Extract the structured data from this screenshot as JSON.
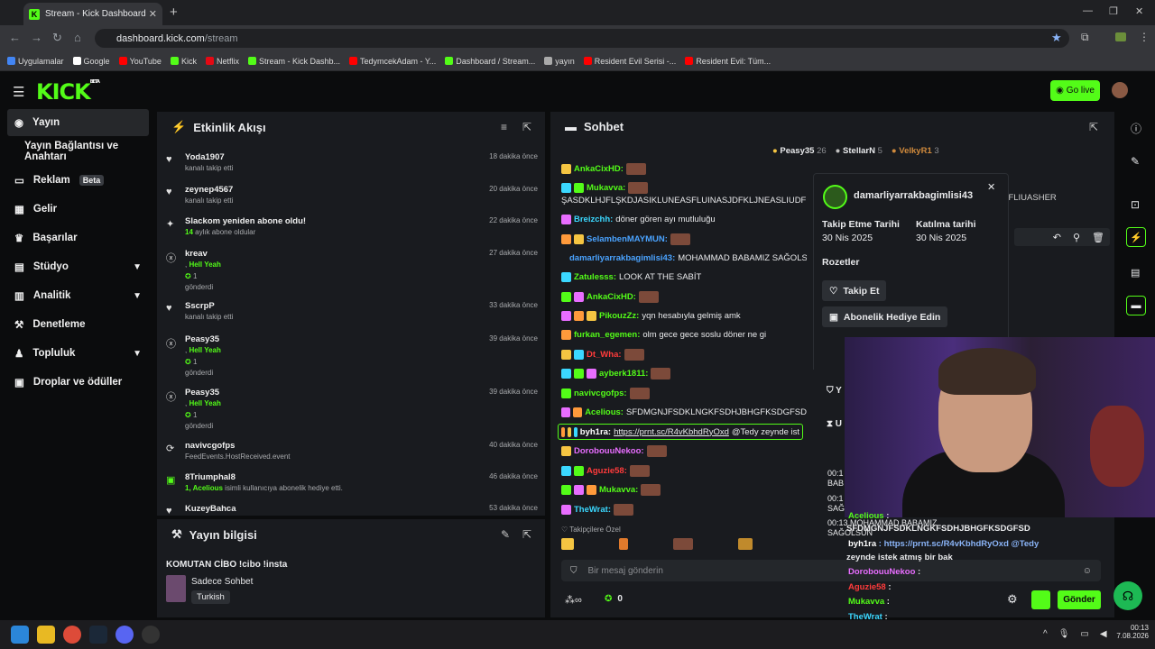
{
  "browser": {
    "tab_title": "Stream - Kick Dashboard",
    "url_host": "dashboard.kick.com",
    "url_path": "/stream",
    "bookmarks": [
      "Uygulamalar",
      "Google",
      "YouTube",
      "Kick",
      "Netflix",
      "Stream - Kick Dashb...",
      "TedymcekAdam - Y...",
      "Dashboard / Stream...",
      "yayın",
      "Resident Evil Serisi -...",
      "Resident Evil: Tüm..."
    ]
  },
  "header": {
    "logo": "KICK",
    "logo_sup": "BETA",
    "go_live": "Go live"
  },
  "sidebar": {
    "items": [
      {
        "label": "Yayın",
        "icon": "broadcast-icon"
      },
      {
        "label": "Yayın Bağlantısı ve Anahtarı"
      },
      {
        "label": "Reklam",
        "badge": "Beta"
      },
      {
        "label": "Gelir"
      },
      {
        "label": "Başarılar"
      },
      {
        "label": "Stüdyo"
      },
      {
        "label": "Analitik"
      },
      {
        "label": "Denetleme"
      },
      {
        "label": "Topluluk"
      },
      {
        "label": "Droplar ve ödüller"
      }
    ]
  },
  "activity": {
    "title": "Etkinlik Akışı",
    "events": [
      {
        "user": "Yoda1907",
        "line2": "kanalı takip etti",
        "time": "18 dakika önce"
      },
      {
        "user": "zeynep4567",
        "line2": "kanalı takip etti",
        "time": "20 dakika önce"
      },
      {
        "user": "Slackom yeniden abone oldu!",
        "line2_a": "14",
        "line2_b": " aylık abone oldular",
        "time": "22 dakika önce"
      },
      {
        "user": "kreav",
        "line2": "Hell Yeah",
        "line3": "1",
        "line4": "gönderdi",
        "time": "27 dakika önce"
      },
      {
        "user": "SscrpP",
        "line2": "kanalı takip etti",
        "time": "33 dakika önce"
      },
      {
        "user": "Peasy35",
        "line2": "Hell Yeah",
        "line3": "1",
        "line4": "gönderdi",
        "time": "39 dakika önce"
      },
      {
        "user": "Peasy35",
        "line2": "Hell Yeah",
        "line3": "1",
        "line4": "gönderdi",
        "time": "39 dakika önce"
      },
      {
        "user": "navivcgofps",
        "line2": "FeedEvents.HostReceived.event",
        "time": "40 dakika önce"
      },
      {
        "user": "8Triumphal8",
        "line2_a": "1, Acelious",
        "line2_b": " isimli kullanıcıya abonelik hediye etti.",
        "time": "46 dakika önce"
      },
      {
        "user": "KuzeyBahca",
        "line2": "",
        "time": "53 dakika önce"
      }
    ]
  },
  "stream_info": {
    "title": "Yayın bilgisi",
    "stream_title": "KOMUTAN CİBO !cibo !insta",
    "category": "Sadece Sohbet",
    "tag": "Turkish"
  },
  "chat": {
    "title": "Sohbet",
    "leaders": [
      {
        "name": "Peasy35",
        "count": "26"
      },
      {
        "name": "StellarN",
        "count": "5"
      },
      {
        "name": "VelkyR1",
        "count": "3"
      }
    ],
    "messages": [
      {
        "user": "AnkaCixHD:",
        "color": "#53fc18",
        "text": ""
      },
      {
        "user": "Mukavva:",
        "color": "#53fc18",
        "text": ""
      },
      {
        "user": "",
        "color": "#fff",
        "text": "ŞASDKLHJFLŞKDJASIKLUNEASFLUINASJDFKLJNEASLIUDF"
      },
      {
        "user": "Breizchh:",
        "color": "#3bd8ff",
        "text": "döner gören ayı mutluluğu"
      },
      {
        "user": "SelambenMAYMUN:",
        "color": "#4aa3ff",
        "text": ""
      },
      {
        "user": "damarliyarrakbagimlisi43:",
        "color": "#4aa3ff",
        "text": "MOHAMMAD BABAMIZ SAĞOLSUN"
      },
      {
        "user": "Zatulesss:",
        "color": "#53fc18",
        "text": "LOOK AT THE SABİT"
      },
      {
        "user": "AnkaCixHD:",
        "color": "#53fc18",
        "text": ""
      },
      {
        "user": "PikouzZz:",
        "color": "#53fc18",
        "text": "yqn hesabıyla gelmiş amk"
      },
      {
        "user": "furkan_egemen:",
        "color": "#53fc18",
        "text": "olm gece gece soslu döner ne gi"
      },
      {
        "user": "Dt_Wha:",
        "color": "#ff3b3b",
        "text": ""
      },
      {
        "user": "ayberk1811:",
        "color": "#53fc18",
        "text": ""
      },
      {
        "user": "navivcgofps:",
        "color": "#53fc18",
        "text": ""
      },
      {
        "user": "Acelious:",
        "color": "#53fc18",
        "text": "SFDMGNJFSDKLNGKFSDHJBHGFKSDGFSD"
      },
      {
        "user": "byh1ra:",
        "color": "#ffffff",
        "text": "https://prnt.sc/R4vKbhdRyOxd",
        "text2": " @Tedy zeynde ist"
      },
      {
        "user": "DorobouuNekoo:",
        "color": "#e86dff",
        "text": ""
      },
      {
        "user": "Aguzie58:",
        "color": "#ff3b3b",
        "text": ""
      },
      {
        "user": "Mukavva:",
        "color": "#53fc18",
        "text": ""
      },
      {
        "user": "TheWrat:",
        "color": "#3bd8ff",
        "text": ""
      }
    ],
    "pinned_label": "Takipçilere Özel",
    "input_placeholder": "Bir mesaj gönderin",
    "points": "0",
    "send": "Gönder"
  },
  "user_card": {
    "username": "damarliyarrakbagimlisi43",
    "follow_label": "Takip Etme Tarihi",
    "follow_date": "30 Nis 2025",
    "join_label": "Katılma tarihi",
    "join_date": "30 Nis 2025",
    "badges": "Rozetler",
    "follow_btn": "Takip Et",
    "gift_btn": "Abonelik Hediye Edin",
    "behind_text": "NEROFLIUASHER"
  },
  "overlay": {
    "lines": [
      {
        "user": "Acelious",
        "text": " :"
      },
      {
        "user": "",
        "text": "SFDMGNJFSDKLNGKFSDHJBHGFKSDGFSD"
      },
      {
        "user": "byh1ra",
        "text": " : https://prnt.sc/R4vKbhdRyOxd @Tedy"
      },
      {
        "user": "",
        "text": "zeynde istek atmış bir bak"
      },
      {
        "user": "DorobouuNekoo",
        "text": " :"
      },
      {
        "user": "Aguzie58",
        "text": " :"
      },
      {
        "user": "Mukavva",
        "text": " :"
      },
      {
        "user": "TheWrat",
        "text": " :"
      }
    ],
    "times": [
      "00:1",
      "BAB",
      "00:1",
      "SAĞ",
      "00:13 MOHAMMAD BABAMIZ",
      "SAĞOLSUN"
    ]
  },
  "taskbar": {
    "time": "00:13",
    "date": "7.08.2026"
  },
  "colors": {
    "brand": "#53fc18",
    "panel": "#191b1f",
    "bg": "#0b0c0d"
  }
}
